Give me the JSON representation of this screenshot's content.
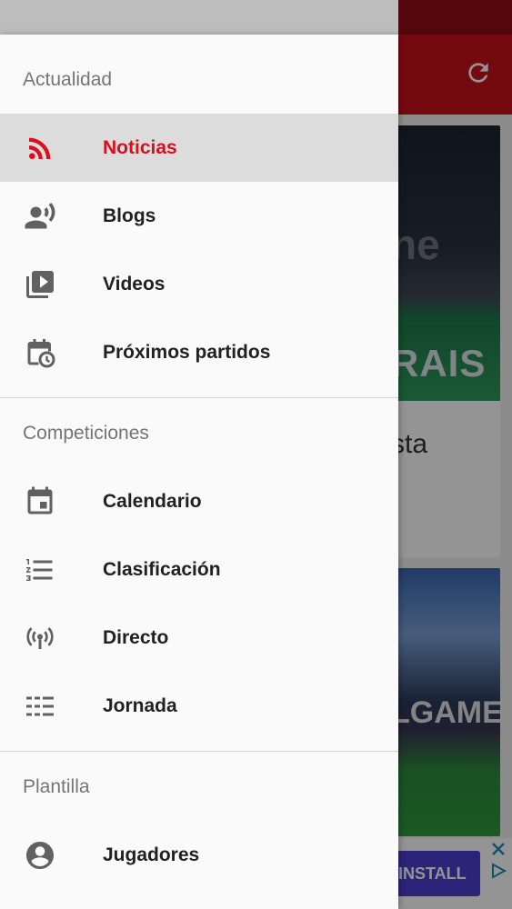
{
  "colors": {
    "accent": "#d8101d",
    "toolbar": "#c8101d",
    "drawer_bg": "#fafafa",
    "active_row": "#dcdcdc",
    "icon_gray": "#616161",
    "section_gray": "#757575"
  },
  "background": {
    "card1_partial_text": "sta",
    "ad_button_label": "INSTALL"
  },
  "drawer": {
    "sections": [
      {
        "title": "Actualidad",
        "items": [
          {
            "label": "Noticias",
            "icon": "rss-feed-icon",
            "active": true
          },
          {
            "label": "Blogs",
            "icon": "record-voice-icon",
            "active": false
          },
          {
            "label": "Videos",
            "icon": "video-library-icon",
            "active": false
          },
          {
            "label": "Próximos partidos",
            "icon": "calendar-clock-icon",
            "active": false
          }
        ]
      },
      {
        "title": "Competiciones",
        "items": [
          {
            "label": "Calendario",
            "icon": "calendar-icon",
            "active": false
          },
          {
            "label": "Clasificación",
            "icon": "numbered-list-icon",
            "active": false
          },
          {
            "label": "Directo",
            "icon": "live-broadcast-icon",
            "active": false
          },
          {
            "label": "Jornada",
            "icon": "schedule-list-icon",
            "active": false
          }
        ]
      },
      {
        "title": "Plantilla",
        "items": [
          {
            "label": "Jugadores",
            "icon": "account-circle-icon",
            "active": false
          }
        ]
      }
    ]
  }
}
